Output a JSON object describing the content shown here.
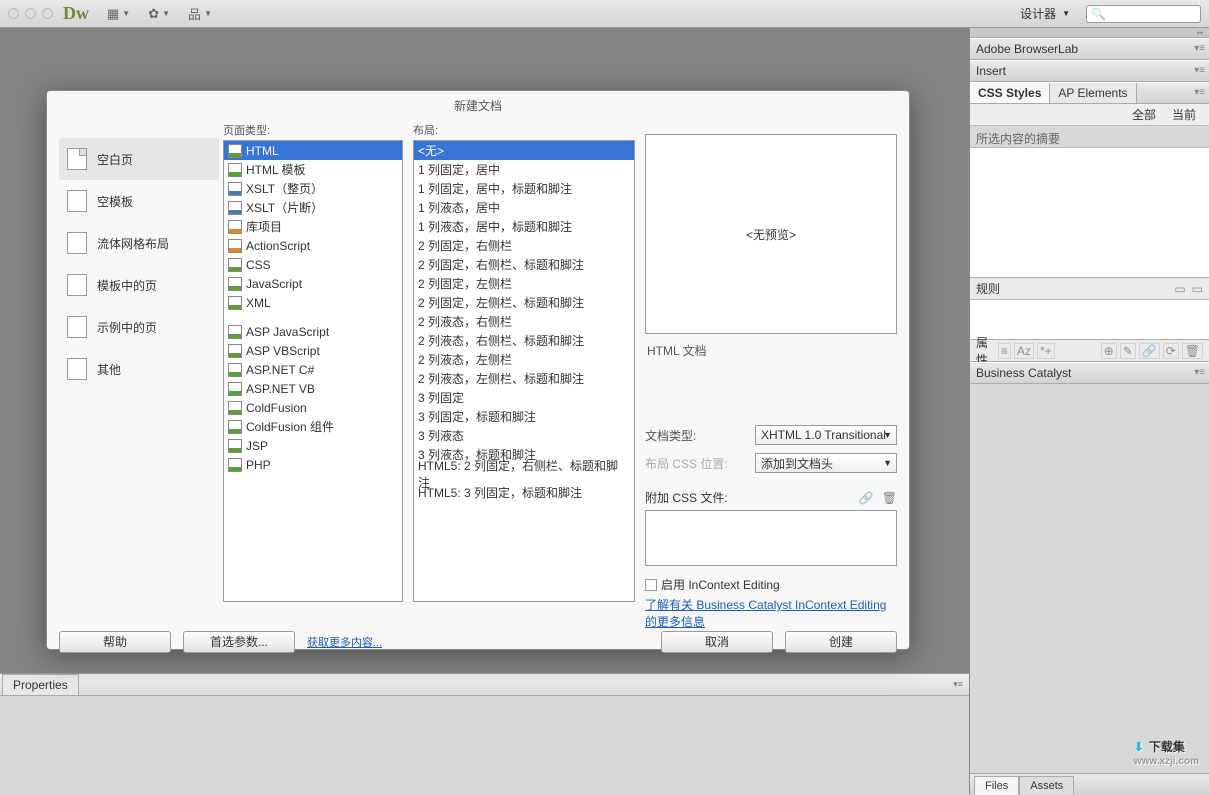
{
  "topbar": {
    "workspace": "设计器"
  },
  "panels": {
    "browserlab": "Adobe BrowserLab",
    "insert": "Insert",
    "css_styles": "CSS Styles",
    "ap_elements": "AP Elements",
    "css_all": "全部",
    "css_current": "当前",
    "summary": "所选内容的摘要",
    "rules": "规则",
    "attrs": "属性",
    "business_catalyst": "Business Catalyst",
    "files": "Files",
    "assets": "Assets",
    "properties": "Properties"
  },
  "dialog": {
    "title": "新建文档",
    "col_pagetype": "页面类型:",
    "col_layout": "布局:",
    "categories": [
      "空白页",
      "空模板",
      "流体网格布局",
      "模板中的页",
      "示例中的页",
      "其他"
    ],
    "page_types": [
      "HTML",
      "HTML 模板",
      "XSLT（整页）",
      "XSLT（片断）",
      "库项目",
      "ActionScript",
      "CSS",
      "JavaScript",
      "XML",
      "",
      "ASP JavaScript",
      "ASP VBScript",
      "ASP.NET C#",
      "ASP.NET VB",
      "ColdFusion",
      "ColdFusion 组件",
      "JSP",
      "PHP"
    ],
    "layouts": [
      "<无>",
      "1 列固定，居中",
      "1 列固定，居中，标题和脚注",
      "1 列液态，居中",
      "1 列液态，居中，标题和脚注",
      "2 列固定，右侧栏",
      "2 列固定，右侧栏、标题和脚注",
      "2 列固定，左侧栏",
      "2 列固定，左侧栏、标题和脚注",
      "2 列液态，右侧栏",
      "2 列液态，右侧栏、标题和脚注",
      "2 列液态，左侧栏",
      "2 列液态，左侧栏、标题和脚注",
      "3 列固定",
      "3 列固定，标题和脚注",
      "3 列液态",
      "3 列液态，标题和脚注",
      "HTML5: 2 列固定，右侧栏、标题和脚注",
      "HTML5: 3 列固定，标题和脚注"
    ],
    "no_preview": "<无预览>",
    "desc": "HTML 文档",
    "doctype_label": "文档类型:",
    "doctype_value": "XHTML 1.0 Transitional",
    "layoutcss_label": "布局 CSS 位置:",
    "layoutcss_value": "添加到文档头",
    "attachcss_label": "附加 CSS 文件:",
    "enable_ice": "启用 InContext Editing",
    "ice_link": "了解有关 Business Catalyst InContext Editing 的更多信息",
    "btn_help": "帮助",
    "btn_prefs": "首选参数...",
    "link_more": "获取更多内容...",
    "btn_cancel": "取消",
    "btn_create": "创建"
  },
  "watermark": {
    "brand": "下载集",
    "url": "www.xzji.com"
  }
}
